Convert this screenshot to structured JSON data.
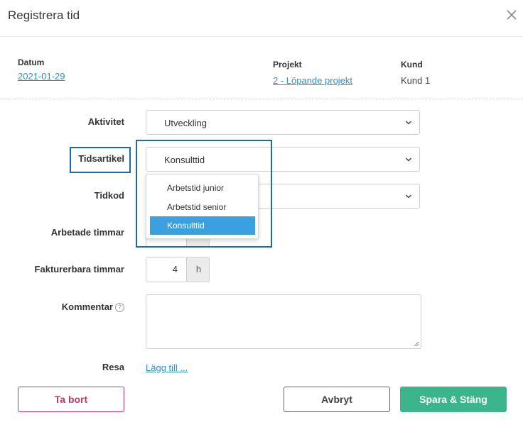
{
  "dialog": {
    "title": "Registrera tid",
    "close_icon": "close-icon"
  },
  "meta": {
    "datum_label": "Datum",
    "datum_value": "2021-01-29",
    "projekt_label": "Projekt",
    "projekt_value": "2 - Löpande projekt",
    "kund_label": "Kund",
    "kund_value": "Kund 1"
  },
  "form": {
    "aktivitet": {
      "label": "Aktivitet",
      "value": "Utveckling"
    },
    "tidsartikel": {
      "label": "Tidsartikel",
      "value": "Konsulttid",
      "options": [
        "Arbetstid junior",
        "Arbetstid senior",
        "Konsulttid"
      ],
      "selected_option": "Konsulttid"
    },
    "tidkod": {
      "label": "Tidkod",
      "value": ""
    },
    "arbetade_timmar": {
      "label": "Arbetade timmar"
    },
    "fakturerbara_timmar": {
      "label": "Fakturerbara timmar",
      "value": "4",
      "unit": "h"
    },
    "kommentar": {
      "label": "Kommentar",
      "help_icon": "help-icon",
      "help_glyph": "?",
      "value": ""
    },
    "resa": {
      "label": "Resa",
      "link": "Lägg till ..."
    }
  },
  "buttons": {
    "delete": "Ta bort",
    "cancel": "Avbryt",
    "save": "Spara & Stäng"
  },
  "colors": {
    "link": "#2e8fc9",
    "highlight_border": "#1c6aa6",
    "selected_option_bg": "#3aa0e0",
    "delete": "#c7336b",
    "save": "#3cb48c"
  }
}
